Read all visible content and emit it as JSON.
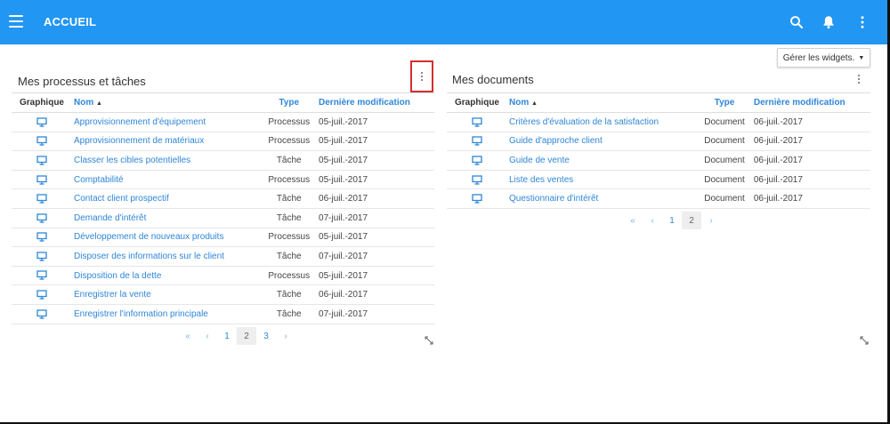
{
  "header": {
    "title": "ACCUEIL",
    "background_color": "#2196f3",
    "icons": [
      "menu-icon",
      "search-icon",
      "bell-icon",
      "more-vert-icon"
    ]
  },
  "manage_widgets_label": "Gérer les widgets.",
  "processes_widget": {
    "title": "Mes processus et tâches",
    "columns": {
      "graph": "Graphique",
      "name": "Nom",
      "type": "Type",
      "date": "Dernière modification"
    },
    "rows": [
      {
        "name": "Approvisionnement d'équipement",
        "type": "Processus",
        "date": "05-juil.-2017"
      },
      {
        "name": "Approvisionnement de matériaux",
        "type": "Processus",
        "date": "05-juil.-2017"
      },
      {
        "name": "Classer les cibles potentielles",
        "type": "Tâche",
        "date": "05-juil.-2017"
      },
      {
        "name": "Comptabilité",
        "type": "Processus",
        "date": "05-juil.-2017"
      },
      {
        "name": "Contact client prospectif",
        "type": "Tâche",
        "date": "06-juil.-2017"
      },
      {
        "name": "Demande d'intérêt",
        "type": "Tâche",
        "date": "07-juil.-2017"
      },
      {
        "name": "Développement de nouveaux produits",
        "type": "Processus",
        "date": "05-juil.-2017"
      },
      {
        "name": "Disposer des informations sur le client",
        "type": "Tâche",
        "date": "07-juil.-2017"
      },
      {
        "name": "Disposition de la dette",
        "type": "Processus",
        "date": "05-juil.-2017"
      },
      {
        "name": "Enregistrer la vente",
        "type": "Tâche",
        "date": "06-juil.-2017"
      },
      {
        "name": "Enregistrer l'information principale",
        "type": "Tâche",
        "date": "07-juil.-2017"
      }
    ],
    "pagination": {
      "first": "«",
      "prev": "‹",
      "pages": [
        "1",
        "2",
        "3"
      ],
      "current": "2",
      "next": "›"
    }
  },
  "documents_widget": {
    "title": "Mes documents",
    "columns": {
      "graph": "Graphique",
      "name": "Nom",
      "type": "Type",
      "date": "Dernière modification"
    },
    "rows": [
      {
        "name": "Critères d'évaluation de la satisfaction",
        "type": "Document",
        "date": "06-juil.-2017"
      },
      {
        "name": "Guide d'approche client",
        "type": "Document",
        "date": "06-juil.-2017"
      },
      {
        "name": "Guide de vente",
        "type": "Document",
        "date": "06-juil.-2017"
      },
      {
        "name": "Liste des ventes",
        "type": "Document",
        "date": "06-juil.-2017"
      },
      {
        "name": "Questionnaire d'intérêt",
        "type": "Document",
        "date": "06-juil.-2017"
      }
    ],
    "pagination": {
      "first": "«",
      "prev": "‹",
      "pages": [
        "1",
        "2"
      ],
      "current": "2",
      "next": "›"
    }
  },
  "colors": {
    "link": "#2f86d8",
    "highlight_box": "#d32f2f"
  }
}
